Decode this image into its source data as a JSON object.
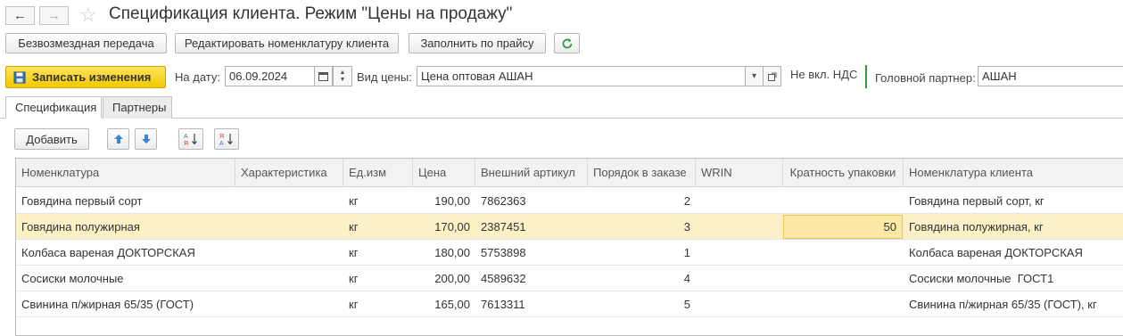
{
  "window": {
    "title": "Спецификация клиента. Режим \"Цены на продажу\""
  },
  "toolbar": {
    "buttons": [
      {
        "label": "Безвозмездная передача"
      },
      {
        "label": "Редактировать номенклатуру клиента"
      },
      {
        "label": "Заполнить по прайсу"
      }
    ],
    "refresh_icon": "refresh-icon"
  },
  "form": {
    "save_label": "Записать изменения",
    "date_label": "На дату:",
    "date_value": "06.09.2024",
    "price_type_label": "Вид цены:",
    "price_type_value": "Цена оптовая АШАН",
    "vat_text": "Не вкл. НДС",
    "partner_label": "Головной партнер:",
    "partner_value": "АШАН"
  },
  "tabs": [
    {
      "label": "Спецификация",
      "active": true
    },
    {
      "label": "Партнеры",
      "active": false
    }
  ],
  "table_toolbar": {
    "add_label": "Добавить"
  },
  "table": {
    "columns": [
      "Номенклатура",
      "Характеристика",
      "Ед.изм",
      "Цена",
      "Внешний артикул",
      "Порядок в заказе",
      "WRIN",
      "Кратность упаковки",
      "Номенклатура клиента"
    ],
    "rows": [
      [
        "Говядина первый сорт",
        "",
        "кг",
        "190,00",
        "7862363",
        "2",
        "",
        "",
        "Говядина первый сорт, кг"
      ],
      [
        "Говядина полужирная",
        "",
        "кг",
        "170,00",
        "2387451",
        "3",
        "",
        "50",
        "Говядина полужирная, кг"
      ],
      [
        "Колбаса вареная ДОКТОРСКАЯ",
        "",
        "кг",
        "180,00",
        "5753898",
        "1",
        "",
        "",
        "Колбаса вареная ДОКТОРСКАЯ"
      ],
      [
        "Сосиски молочные",
        "",
        "кг",
        "200,00",
        "4589632",
        "4",
        "",
        "",
        "Сосиски молочные  ГОСТ1"
      ],
      [
        "Свинина п/жирная 65/35 (ГОСТ)",
        "",
        "кг",
        "165,00",
        "7613311",
        "5",
        "",
        "",
        "Свинина п/жирная 65/35 (ГОСТ), кг"
      ]
    ],
    "selected_row": 1
  },
  "colors": {
    "accent_yellow": "#f2c800",
    "selected_row": "#fbf0c6",
    "edit_cell": "#fbe9a5",
    "refresh_green": "#2e9b3a",
    "arrow_blue": "#3a86d4"
  }
}
